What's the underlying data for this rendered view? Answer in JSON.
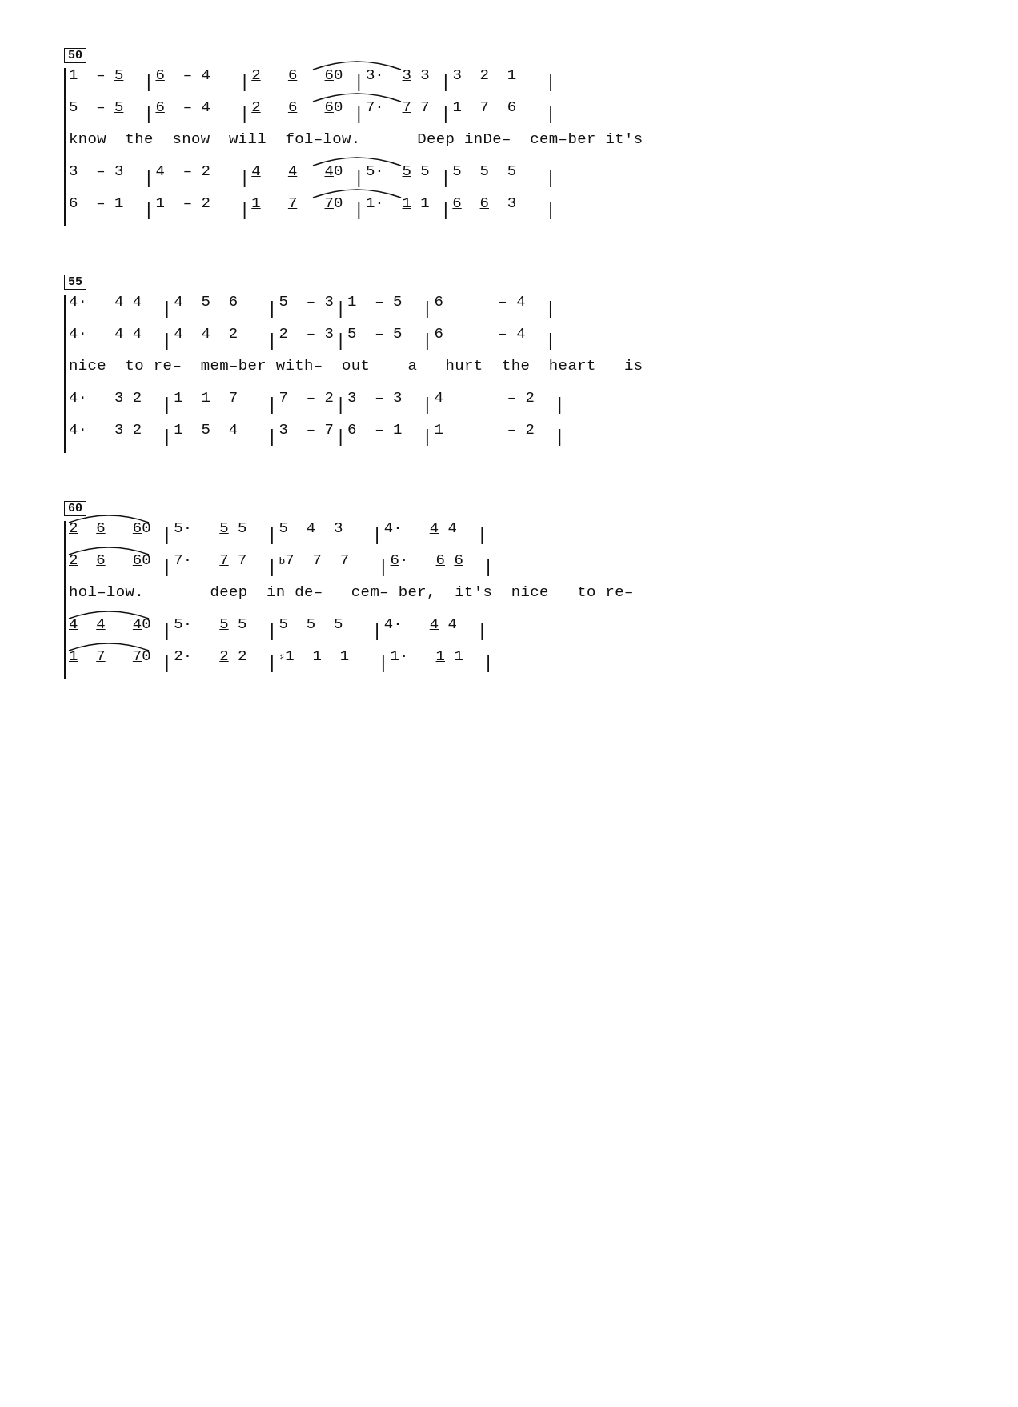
{
  "sections": [
    {
      "measure_number": "50",
      "rows": [
        {
          "type": "music",
          "content": "1  – 5̲  |6̲  – 4   |2̲  6̲  6̲0 |3·  3̲ 3 |3  2  1   |"
        },
        {
          "type": "music",
          "content": "5  – 5̲  |6̲  – 4   |2̲  6̲  6̲0 |7·  7̲ 7 |1  7  6   |"
        },
        {
          "type": "lyric",
          "content": "know  the  snow  will  fol-low.      Deep inDe-  cem-ber it's"
        },
        {
          "type": "music",
          "content": "3  – 3  |4  – 2   |4̲  4̲  4̲0 |5·  5̲ 5 |5  5  5   |"
        },
        {
          "type": "music",
          "content": "6  – 1  |1  – 2   |1̲  7̲  7̲0 |1·  1̲ 1 |6̲  6̲  3   |"
        }
      ]
    },
    {
      "measure_number": "55",
      "rows": [
        {
          "type": "music",
          "content": "4·   4̲ 4  |4  5  6   |5  – 3|1  – 5̲  |6̲      – 4  |"
        },
        {
          "type": "music",
          "content": "4·   4̲ 4  |4  4  2   |2  – 3|5̲  – 5̲  |6̲      – 4  |"
        },
        {
          "type": "lyric",
          "content": "nice  to re-  mem-ber with-  out   a   hurt  the  heart   is"
        },
        {
          "type": "music",
          "content": "4·   3̲ 2  |1  1  7   |7  – 2|3  – 3  |4       – 2  |"
        },
        {
          "type": "music",
          "content": "4·   3̲ 2  |1  5̲  4   |3  – 7|6̲  – 1  |1       – 2  |"
        }
      ]
    },
    {
      "measure_number": "60",
      "rows": [
        {
          "type": "music",
          "content": "2̲  6̲  6̲0 |5·   5̲ 5  |5  4  3   |4·   4̲ 4  |"
        },
        {
          "type": "music",
          "content": "2̲  6̲  6̲0 |7·   7̲ 7  |♭7  7  7   |6·   6̲ 6̲  |"
        },
        {
          "type": "lyric",
          "content": "hol-low.       deep  in de-   cem- ber,  it's  nice   to re-"
        },
        {
          "type": "music",
          "content": "4̲  4̲  4̲0 |5·   5̲ 5  |5  5  5   |4·   4̲ 4  |"
        },
        {
          "type": "music",
          "content": "1̲  7̲  7̲0 |2·   2̲ 2  |♯1  1  1   |1·   1̲ 1  |"
        }
      ]
    }
  ]
}
